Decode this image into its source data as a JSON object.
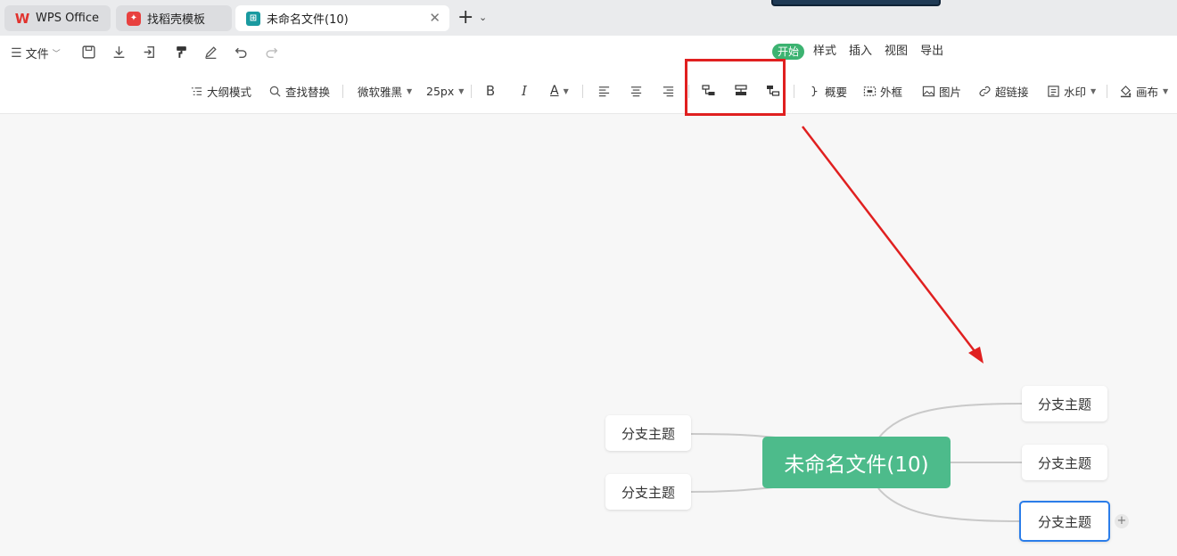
{
  "tabs": [
    {
      "label": "WPS Office",
      "icon": "wps-logo-icon"
    },
    {
      "label": "找稻壳模板",
      "icon": "docer-icon"
    },
    {
      "label": "未命名文件(10)",
      "icon": "mindmap-icon",
      "active": true
    }
  ],
  "row2": {
    "file_label": "文件",
    "menu_tabs": [
      "开始",
      "样式",
      "插入",
      "视图",
      "导出"
    ],
    "active_menu": "开始"
  },
  "toolbar": {
    "outline": "大纲模式",
    "find_replace": "查找替换",
    "font": "微软雅黑",
    "font_size": "25px",
    "bold": "B",
    "italic": "I",
    "font_color": "A",
    "summary": "概要",
    "frame": "外框",
    "image": "图片",
    "hyperlink": "超链接",
    "watermark": "水印",
    "canvas": "画布"
  },
  "mindmap": {
    "root": "未命名文件(10)",
    "branches": [
      "分支主题",
      "分支主题",
      "分支主题",
      "分支主题",
      "分支主题"
    ],
    "root_color": "#4dbb8b",
    "selected_color": "#2b7de9"
  },
  "annotation": {
    "color": "#e02020"
  }
}
